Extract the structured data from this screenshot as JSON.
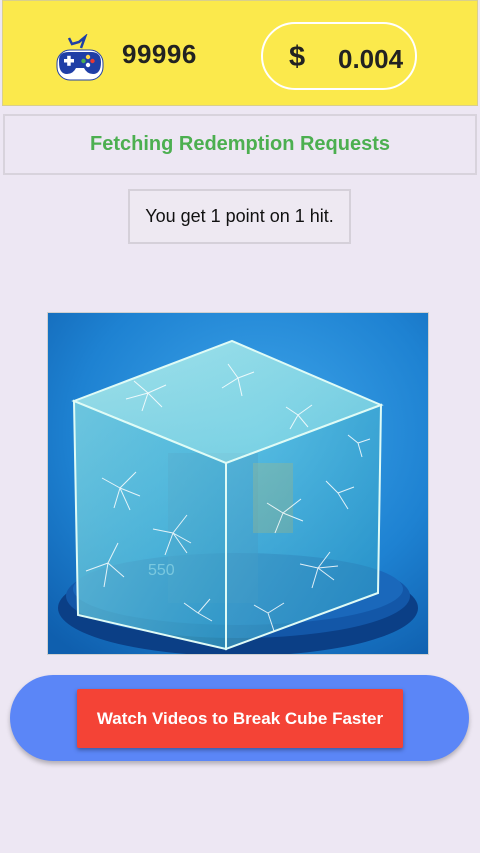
{
  "header": {
    "points": "99996",
    "currency_symbol": "$",
    "money": "0.004",
    "icon": "gamepad-icon"
  },
  "status": {
    "text": "Fetching Redemption Requests"
  },
  "info": {
    "text": "You get 1 point on 1 hit."
  },
  "cube": {
    "image": "cracked-glass-cube",
    "visible_label": "550"
  },
  "actions": {
    "watch_label": "Watch Videos to Break Cube Faster"
  },
  "colors": {
    "header_bg": "#fbe94c",
    "status_text": "#4caf50",
    "action_bar": "#5b86f7",
    "watch_button": "#f44336",
    "page_bg": "#ede7f3"
  }
}
